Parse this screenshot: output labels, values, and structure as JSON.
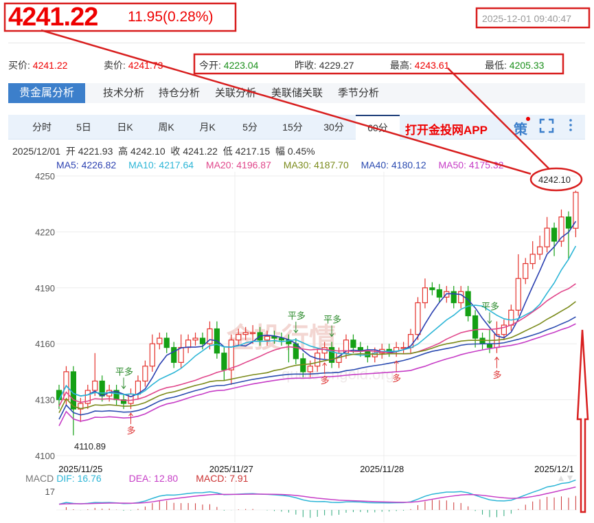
{
  "header": {
    "price": "4241.22",
    "change": "11.95(0.28%)",
    "timestamp": "2025-12-01 09:40:47"
  },
  "quote": {
    "bid_label": "买价:",
    "bid": "4241.22",
    "ask_label": "卖价:",
    "ask": "4241.73",
    "open_label": "今开:",
    "open": "4223.04",
    "prev_label": "昨收:",
    "prev": "4229.27",
    "high_label": "最高:",
    "high": "4243.61",
    "low_label": "最低:",
    "low": "4205.33"
  },
  "tabs": [
    "贵金属分析",
    "技术分析",
    "持仓分析",
    "关联分析",
    "美联储关联",
    "季节分析"
  ],
  "periods": [
    "分时",
    "5日",
    "日K",
    "周K",
    "月K",
    "5分",
    "15分",
    "30分",
    "60分"
  ],
  "active_period": "60分",
  "app_link": "打开金投网APP",
  "strategy_icon": "策",
  "bar_info": {
    "date": "2025/12/01",
    "open_label": "开",
    "open": "4221.93",
    "high_label": "高",
    "high": "4242.10",
    "close_label": "收",
    "close": "4241.22",
    "low_label": "低",
    "low": "4217.15",
    "amp_label": "幅",
    "amp": "0.45%"
  },
  "ma": [
    {
      "label": "MA5: 4226.82",
      "color": "#2a3fb0"
    },
    {
      "label": "MA10: 4217.64",
      "color": "#2bb5d6"
    },
    {
      "label": "MA20: 4196.87",
      "color": "#e0458a"
    },
    {
      "label": "MA30: 4187.70",
      "color": "#7a8a1a"
    },
    {
      "label": "MA40: 4180.12",
      "color": "#2a4ab0"
    },
    {
      "label": "MA50: 4175.32",
      "color": "#c63cc6"
    }
  ],
  "watermark": "金投行情",
  "watermark_url": "quote.cngold.org",
  "annotations": {
    "max": "4242.10",
    "min": "4110.89"
  },
  "signals": [
    {
      "i": 9,
      "type": "平多"
    },
    {
      "i": 10,
      "type": "多"
    },
    {
      "i": 33,
      "type": "平多"
    },
    {
      "i": 38,
      "type": "平多"
    },
    {
      "i": 37,
      "type": "多"
    },
    {
      "i": 47,
      "type": "多"
    },
    {
      "i": 60,
      "type": "平多"
    },
    {
      "i": 61,
      "type": "多"
    }
  ],
  "macd": {
    "label": "MACD",
    "dif": "DIF: 16.76",
    "dea": "DEA: 12.80",
    "macd": "MACD: 7.91",
    "axis": "17"
  },
  "chart_data": {
    "type": "candlestick",
    "ylim": [
      4100,
      4250
    ],
    "yticks": [
      "4250",
      "4220",
      "4190",
      "4160",
      "4130",
      "4100"
    ],
    "xlabels": [
      {
        "i": 3,
        "label": "2025/11/25"
      },
      {
        "i": 24,
        "label": "2025/11/27"
      },
      {
        "i": 45,
        "label": "2025/11/28"
      },
      {
        "i": 69,
        "label": "2025/12/1"
      }
    ],
    "ohlc": [
      [
        4135,
        4138,
        4125,
        4130
      ],
      [
        4130,
        4148,
        4127,
        4145
      ],
      [
        4145,
        4148,
        4110.89,
        4125
      ],
      [
        4125,
        4131,
        4118,
        4128
      ],
      [
        4128,
        4138,
        4125,
        4135
      ],
      [
        4135,
        4155,
        4132,
        4140
      ],
      [
        4140,
        4143,
        4129,
        4132
      ],
      [
        4132,
        4138,
        4129,
        4135
      ],
      [
        4135,
        4138,
        4127,
        4130
      ],
      [
        4130,
        4133,
        4125,
        4128
      ],
      [
        4128,
        4136,
        4125,
        4133
      ],
      [
        4133,
        4143,
        4130,
        4140
      ],
      [
        4140,
        4151,
        4137,
        4148
      ],
      [
        4148,
        4165,
        4145,
        4160
      ],
      [
        4160,
        4166,
        4157,
        4163
      ],
      [
        4163,
        4166,
        4155,
        4158
      ],
      [
        4158,
        4161,
        4147,
        4150
      ],
      [
        4150,
        4165,
        4147,
        4158
      ],
      [
        4158,
        4165,
        4155,
        4162
      ],
      [
        4162,
        4166,
        4159,
        4163
      ],
      [
        4163,
        4166,
        4157,
        4160
      ],
      [
        4160,
        4172,
        4157,
        4168
      ],
      [
        4168,
        4172,
        4152,
        4155
      ],
      [
        4155,
        4158,
        4140,
        4146
      ],
      [
        4146,
        4165,
        4138,
        4162
      ],
      [
        4162,
        4168,
        4159,
        4165
      ],
      [
        4165,
        4169,
        4162,
        4166
      ],
      [
        4166,
        4170,
        4160,
        4166
      ],
      [
        4166,
        4169,
        4159,
        4162
      ],
      [
        4162,
        4167,
        4159,
        4164
      ],
      [
        4164,
        4167,
        4160,
        4163
      ],
      [
        4163,
        4166,
        4159,
        4162
      ],
      [
        4162,
        4165,
        4150,
        4160
      ],
      [
        4160,
        4163,
        4149,
        4152
      ],
      [
        4152,
        4155,
        4142,
        4145
      ],
      [
        4145,
        4151,
        4142,
        4148
      ],
      [
        4148,
        4158,
        4145,
        4155
      ],
      [
        4155,
        4161,
        4152,
        4158
      ],
      [
        4158,
        4161,
        4147,
        4150
      ],
      [
        4150,
        4158,
        4147,
        4155
      ],
      [
        4155,
        4165,
        4152,
        4162
      ],
      [
        4162,
        4165,
        4155,
        4158
      ],
      [
        4158,
        4161,
        4153,
        4156
      ],
      [
        4156,
        4159,
        4150,
        4153
      ],
      [
        4153,
        4158,
        4150,
        4155
      ],
      [
        4155,
        4160,
        4152,
        4157
      ],
      [
        4157,
        4160,
        4153,
        4156
      ],
      [
        4156,
        4161,
        4153,
        4158
      ],
      [
        4158,
        4161,
        4155,
        4158
      ],
      [
        4158,
        4168,
        4155,
        4165
      ],
      [
        4165,
        4185,
        4162,
        4182
      ],
      [
        4182,
        4195,
        4179,
        4190
      ],
      [
        4190,
        4193,
        4186,
        4189
      ],
      [
        4189,
        4192,
        4182,
        4185
      ],
      [
        4185,
        4191,
        4182,
        4188
      ],
      [
        4188,
        4191,
        4179,
        4182
      ],
      [
        4182,
        4191,
        4179,
        4188
      ],
      [
        4188,
        4191,
        4172,
        4175
      ],
      [
        4175,
        4178,
        4158,
        4163
      ],
      [
        4163,
        4166,
        4157,
        4160
      ],
      [
        4160,
        4168,
        4155,
        4158
      ],
      [
        4158,
        4172,
        4155,
        4165
      ],
      [
        4165,
        4173,
        4162,
        4170
      ],
      [
        4170,
        4181,
        4167,
        4178
      ],
      [
        4178,
        4208,
        4175,
        4195
      ],
      [
        4195,
        4206,
        4192,
        4203
      ],
      [
        4203,
        4215,
        4200,
        4208
      ],
      [
        4208,
        4218,
        4205,
        4212
      ],
      [
        4212,
        4228,
        4209,
        4222
      ],
      [
        4222,
        4225,
        4207,
        4215
      ],
      [
        4215,
        4232,
        4212,
        4228
      ],
      [
        4228,
        4231,
        4205,
        4222
      ],
      [
        4221.93,
        4242.1,
        4217.15,
        4241.22
      ]
    ]
  }
}
